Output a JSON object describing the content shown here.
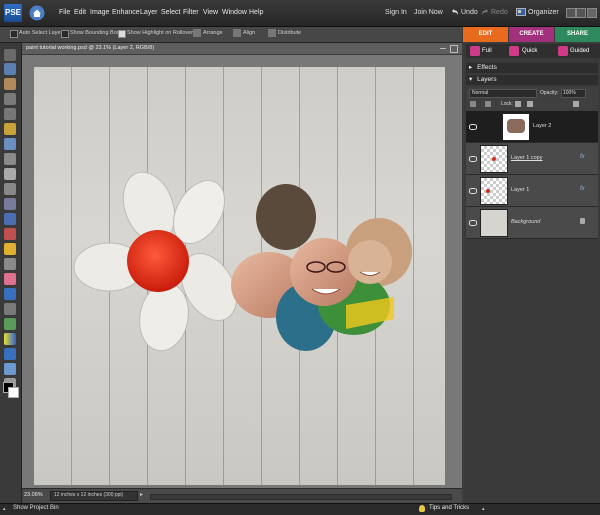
{
  "app": {
    "logo_text": "PSE"
  },
  "menu": [
    "File",
    "Edit",
    "Image",
    "Enhance",
    "Layer",
    "Select",
    "Filter",
    "View",
    "Window",
    "Help"
  ],
  "topright": {
    "sign_in": "Sign In",
    "join_now": "Join Now",
    "undo": "Undo",
    "redo": "Redo",
    "organizer": "Organizer"
  },
  "modes": {
    "edit": "EDIT",
    "create": "CREATE",
    "share": "SHARE",
    "full": "Full",
    "quick": "Quick",
    "guided": "Guided"
  },
  "colors": {
    "edit_tab": "#e86a1c",
    "create_tab": "#a2307c",
    "share_tab": "#2e8a5e",
    "flower_center": "#e5321c",
    "accent_blue": "#2f6fc4"
  },
  "options": {
    "auto_select": "Auto Select Layer",
    "bounding_box": "Show Bounding Box",
    "highlight": "Show Highlight on Rollover",
    "arrange": "Arrange",
    "align": "Align",
    "distribute": "Distribute"
  },
  "document": {
    "title": "paint tutorial working.psd @ 23.1% (Layer 2, RGB/8)",
    "zoom": "23.06%",
    "size_info": "12 inches x 12 inches (300 ppi)"
  },
  "panels": {
    "effects": "Effects",
    "layers": "Layers",
    "blend_mode": "Normal",
    "opacity_label": "Opacity:",
    "opacity_value": "100%",
    "lock_label": "Lock:",
    "layers_list": [
      {
        "name": "Layer 2",
        "fx": ""
      },
      {
        "name": "Layer 1 copy",
        "fx": "fx"
      },
      {
        "name": "Layer 1",
        "fx": "fx"
      },
      {
        "name": "Background",
        "fx": ""
      }
    ]
  },
  "bottom": {
    "project_bin": "Show Project Bin",
    "tips": "Tips and Tricks"
  }
}
